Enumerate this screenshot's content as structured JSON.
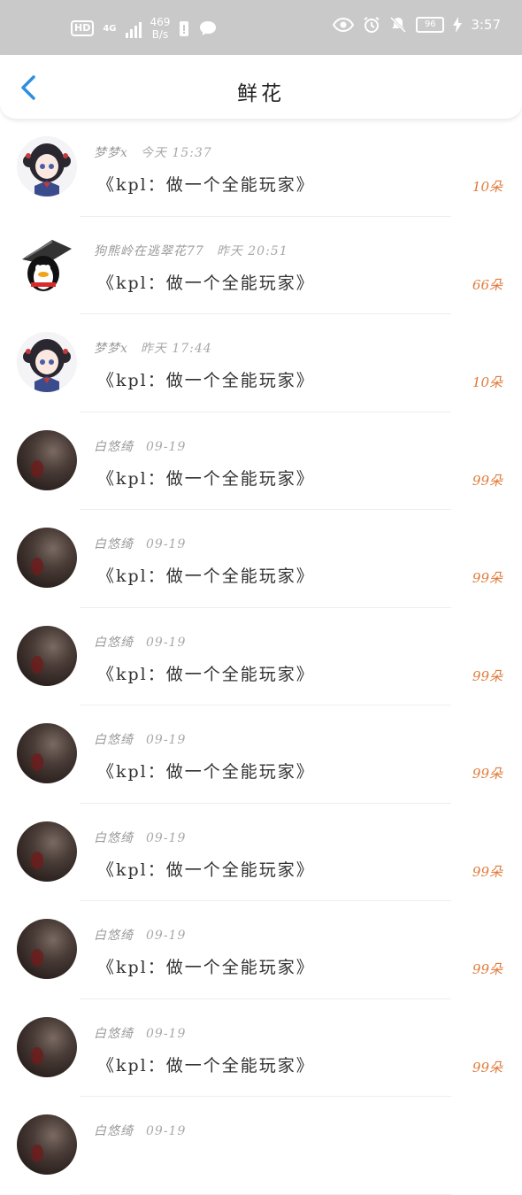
{
  "status_bar": {
    "hd": "HD",
    "network": "4G",
    "speed_value": "469",
    "speed_unit": "B/s",
    "battery": "96",
    "time": "3:57"
  },
  "header": {
    "title": "鲜花"
  },
  "items": [
    {
      "avatar": "anime",
      "name": "梦梦x",
      "time": "今天 15:37",
      "work": "《kpl：做一个全能玩家》",
      "count": "10朵"
    },
    {
      "avatar": "qq",
      "name": "狗熊岭在逃翠花77",
      "time": "昨天 20:51",
      "work": "《kpl：做一个全能玩家》",
      "count": "66朵"
    },
    {
      "avatar": "anime",
      "name": "梦梦x",
      "time": "昨天 17:44",
      "work": "《kpl：做一个全能玩家》",
      "count": "10朵"
    },
    {
      "avatar": "dark",
      "name": "白悠绮",
      "time": "09-19",
      "work": "《kpl：做一个全能玩家》",
      "count": "99朵"
    },
    {
      "avatar": "dark",
      "name": "白悠绮",
      "time": "09-19",
      "work": "《kpl：做一个全能玩家》",
      "count": "99朵"
    },
    {
      "avatar": "dark",
      "name": "白悠绮",
      "time": "09-19",
      "work": "《kpl：做一个全能玩家》",
      "count": "99朵"
    },
    {
      "avatar": "dark",
      "name": "白悠绮",
      "time": "09-19",
      "work": "《kpl：做一个全能玩家》",
      "count": "99朵"
    },
    {
      "avatar": "dark",
      "name": "白悠绮",
      "time": "09-19",
      "work": "《kpl：做一个全能玩家》",
      "count": "99朵"
    },
    {
      "avatar": "dark",
      "name": "白悠绮",
      "time": "09-19",
      "work": "《kpl：做一个全能玩家》",
      "count": "99朵"
    },
    {
      "avatar": "dark",
      "name": "白悠绮",
      "time": "09-19",
      "work": "《kpl：做一个全能玩家》",
      "count": "99朵"
    },
    {
      "avatar": "dark",
      "name": "白悠绮",
      "time": "09-19",
      "work": "",
      "count": ""
    }
  ]
}
